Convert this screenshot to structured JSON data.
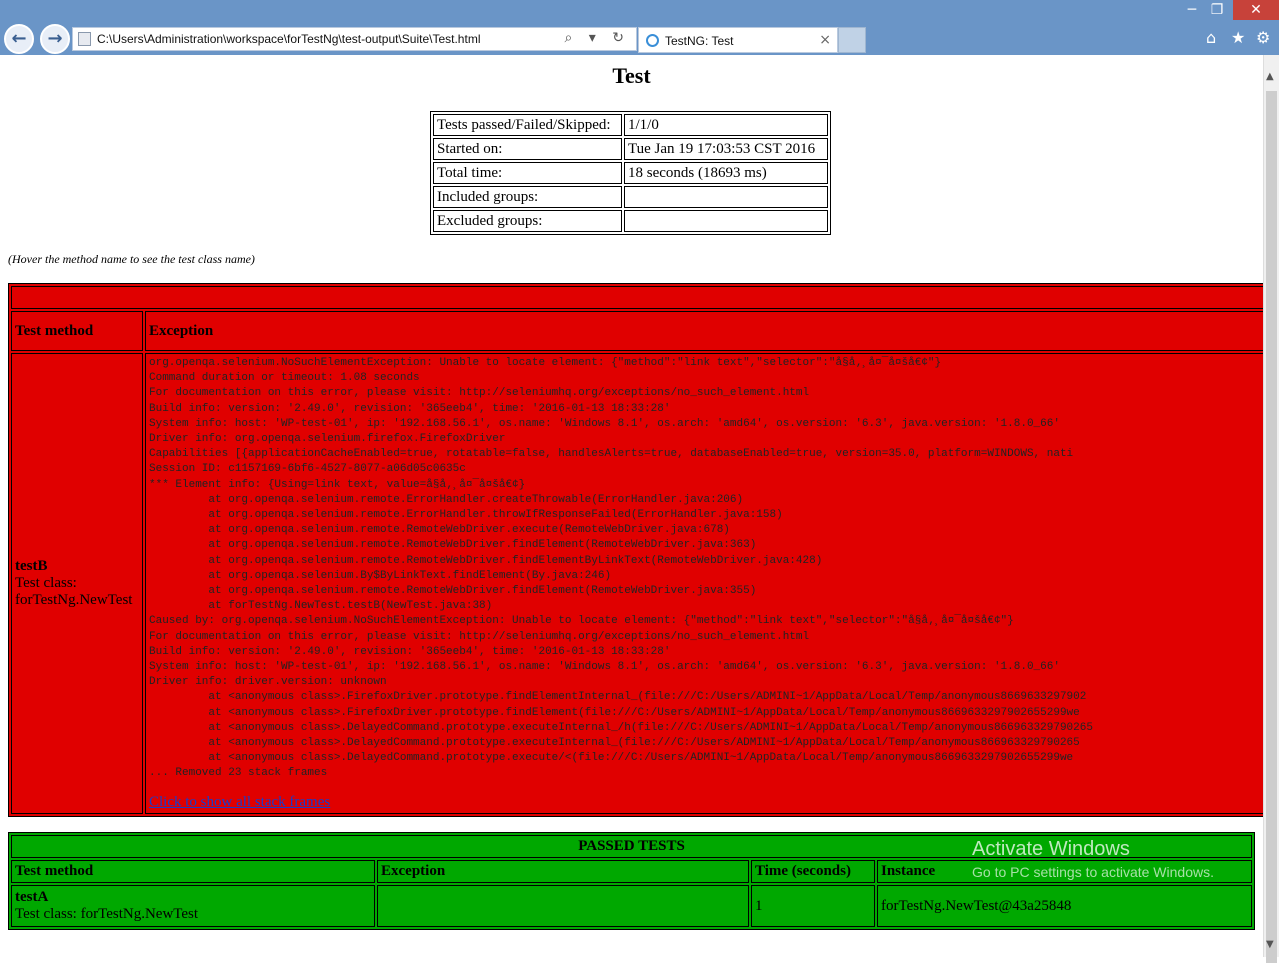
{
  "browser": {
    "address": "C:\\Users\\Administration\\workspace\\forTestNg\\test-output\\Suite\\Test.html",
    "tab_title": "TestNG: Test",
    "address_tools": "⌕ ▾ ↻",
    "tab_close": "×",
    "back_glyph": "←",
    "forward_glyph": "→",
    "win_minimize": "─",
    "win_restore": "❐",
    "win_close": "✕",
    "home_glyph": "⌂",
    "favorites_glyph": "★",
    "settings_glyph": "⚙",
    "scroll_up": "▲",
    "scroll_down": "▼"
  },
  "page": {
    "title": "Test",
    "summary": [
      {
        "label": "Tests passed/Failed/Skipped:",
        "value": "1/1/0"
      },
      {
        "label": "Started on:",
        "value": "Tue Jan 19 17:03:53 CST 2016"
      },
      {
        "label": "Total time:",
        "value": "18 seconds (18693 ms)"
      },
      {
        "label": "Included groups:",
        "value": ""
      },
      {
        "label": "Excluded groups:",
        "value": ""
      }
    ],
    "hover_note": "(Hover the method name to see the test class name)"
  },
  "failed": {
    "header_test_method": "Test method",
    "header_exception": "Exception",
    "row": {
      "method": "testB",
      "class_label": "Test class:",
      "class_name": "forTestNg.NewTest",
      "trace": [
        "org.openqa.selenium.NoSuchElementException: Unable to locate element: {\"method\":\"link text\",\"selector\":\"å§å‚¸å¤¯å¤šå€¢\"}",
        "Command duration or timeout: 1.08 seconds",
        "For documentation on this error, please visit: http://seleniumhq.org/exceptions/no_such_element.html",
        "Build info: version: '2.49.0', revision: '365eeb4', time: '2016-01-13 18:33:28'",
        "System info: host: 'WP-test-01', ip: '192.168.56.1', os.name: 'Windows 8.1', os.arch: 'amd64', os.version: '6.3', java.version: '1.8.0_66'",
        "Driver info: org.openqa.selenium.firefox.FirefoxDriver",
        "Capabilities [{applicationCacheEnabled=true, rotatable=false, handlesAlerts=true, databaseEnabled=true, version=35.0, platform=WINDOWS, nati",
        "Session ID: c1157169-6bf6-4527-8077-a06d05c0635c",
        "*** Element info: {Using=link text, value=å§å‚¸å¤¯å¤šå€¢}",
        "\tat org.openqa.selenium.remote.ErrorHandler.createThrowable(ErrorHandler.java:206)",
        "\tat org.openqa.selenium.remote.ErrorHandler.throwIfResponseFailed(ErrorHandler.java:158)",
        "\tat org.openqa.selenium.remote.RemoteWebDriver.execute(RemoteWebDriver.java:678)",
        "\tat org.openqa.selenium.remote.RemoteWebDriver.findElement(RemoteWebDriver.java:363)",
        "\tat org.openqa.selenium.remote.RemoteWebDriver.findElementByLinkText(RemoteWebDriver.java:428)",
        "\tat org.openqa.selenium.By$ByLinkText.findElement(By.java:246)",
        "\tat org.openqa.selenium.remote.RemoteWebDriver.findElement(RemoteWebDriver.java:355)",
        "\tat forTestNg.NewTest.testB(NewTest.java:38)",
        "Caused by: org.openqa.selenium.NoSuchElementException: Unable to locate element: {\"method\":\"link text\",\"selector\":\"å§å‚¸å¤¯å¤šå€¢\"}",
        "For documentation on this error, please visit: http://seleniumhq.org/exceptions/no_such_element.html",
        "Build info: version: '2.49.0', revision: '365eeb4', time: '2016-01-13 18:33:28'",
        "System info: host: 'WP-test-01', ip: '192.168.56.1', os.name: 'Windows 8.1', os.arch: 'amd64', os.version: '6.3', java.version: '1.8.0_66'",
        "Driver info: driver.version: unknown",
        "\tat <anonymous class>.FirefoxDriver.prototype.findElementInternal_(file:///C:/Users/ADMINI~1/AppData/Local/Temp/anonymous8669633297902",
        "\tat <anonymous class>.FirefoxDriver.prototype.findElement(file:///C:/Users/ADMINI~1/AppData/Local/Temp/anonymous8669633297902655299we",
        "\tat <anonymous class>.DelayedCommand.prototype.executeInternal_/h(file:///C:/Users/ADMINI~1/AppData/Local/Temp/anonymous866963329790265",
        "\tat <anonymous class>.DelayedCommand.prototype.executeInternal_(file:///C:/Users/ADMINI~1/AppData/Local/Temp/anonymous866963329790265",
        "\tat <anonymous class>.DelayedCommand.prototype.execute/<(file:///C:/Users/ADMINI~1/AppData/Local/Temp/anonymous8669633297902655299we",
        "... Removed 23 stack frames"
      ],
      "show_link": "Click to show all stack frames"
    }
  },
  "passed": {
    "title": "PASSED TESTS",
    "headers": [
      "Test method",
      "Exception",
      "Time (seconds)",
      "Instance"
    ],
    "row": {
      "method": "testA",
      "class_line": "Test class: forTestNg.NewTest",
      "exception": "",
      "time": "1",
      "instance": "forTestNg.NewTest@43a25848"
    }
  },
  "watermark": {
    "line1": "Activate Windows",
    "line2": "Go to PC settings to activate Windows."
  },
  "colors": {
    "failed_bg": "#e00000",
    "passed_bg": "#00a800",
    "chrome_bg": "#6a95c7"
  }
}
